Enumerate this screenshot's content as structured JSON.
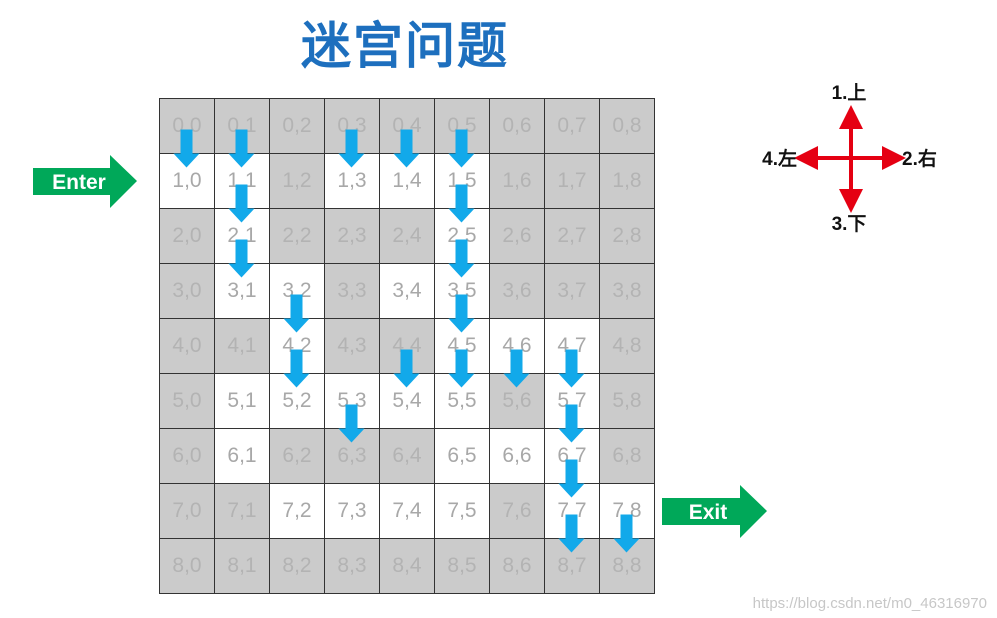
{
  "title": "迷宫问题",
  "enter_label": "Enter",
  "exit_label": "Exit",
  "directions": {
    "up": "1.上",
    "right": "2.右",
    "down": "3.下",
    "left": "4.左"
  },
  "grid": {
    "rows": 9,
    "cols": 9,
    "open_cells": [
      "1,0",
      "1,1",
      "1,3",
      "1,4",
      "1,5",
      "2,1",
      "2,5",
      "3,1",
      "3,2",
      "3,4",
      "3,5",
      "4,2",
      "4,5",
      "4,6",
      "4,7",
      "5,1",
      "5,2",
      "5,3",
      "5,4",
      "5,5",
      "5,7",
      "6,1",
      "6,5",
      "6,6",
      "6,7",
      "7,2",
      "7,3",
      "7,4",
      "7,5",
      "7,7",
      "7,8"
    ]
  },
  "path_arrows": [
    "0,0",
    "0,1",
    "1,1",
    "2,1",
    "3,2",
    "4,2",
    "4,4",
    "0,3",
    "0,4",
    "0,5",
    "1,5",
    "2,5",
    "3,5",
    "4,5",
    "4,6",
    "4,7",
    "5,7",
    "6,7",
    "7,7",
    "7,8",
    "5,3"
  ],
  "colors": {
    "title": "#1d6fbe",
    "wall": "#cbcbcb",
    "arrow": "#12a9ea",
    "direction_arrow": "#e50012",
    "enter_exit": "#00a859"
  },
  "watermark": "https://blog.csdn.net/m0_46316970"
}
